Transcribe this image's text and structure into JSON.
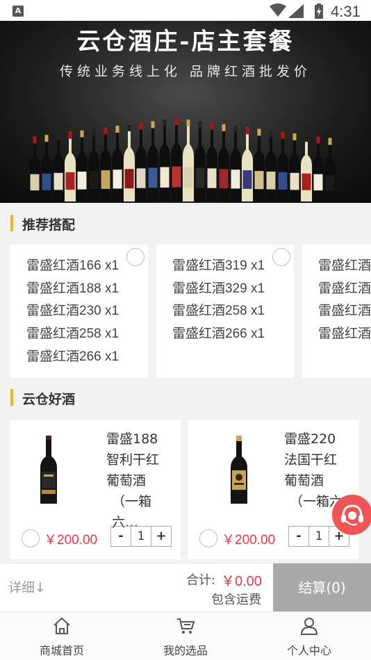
{
  "status_bar": {
    "time": "4:31",
    "left_icon": "A"
  },
  "banner": {
    "title": "云仓酒庄-店主套餐",
    "slogan": "传统业务线上化  品牌红酒批发价"
  },
  "sections": {
    "recommend": "推荐搭配",
    "good_wine": "云仓好酒"
  },
  "combos": [
    {
      "items": [
        "雷盛红酒166 x1",
        "雷盛红酒188 x1",
        "雷盛红酒230 x1",
        "雷盛红酒258 x1",
        "雷盛红酒266 x1"
      ]
    },
    {
      "items": [
        "雷盛红酒319 x1",
        "雷盛红酒329 x1",
        "雷盛红酒258 x1",
        "雷盛红酒266 x1"
      ]
    },
    {
      "items": [
        "雷盛红酒",
        "雷盛红酒",
        "雷盛红酒",
        "雷盛红酒"
      ]
    }
  ],
  "products": [
    {
      "name_lines": [
        "雷盛188",
        "智利干红",
        "葡萄酒",
        "（一箱六…"
      ],
      "price": "￥200.00",
      "qty": "1",
      "minus": "-",
      "plus": "+"
    },
    {
      "name_lines": [
        "雷盛220",
        "法国干红",
        "葡萄酒",
        "（一箱六"
      ],
      "price": "￥200.00",
      "qty": "1",
      "minus": "-",
      "plus": "+"
    }
  ],
  "checkout": {
    "detail": "详细↓",
    "total_label": "合计:",
    "total_value": "￥0.00",
    "shipping": "包含运费",
    "pay_button": "结算(0)"
  },
  "tabs": [
    {
      "label": "商城首页",
      "icon": "home-icon"
    },
    {
      "label": "我的选品",
      "icon": "cart-icon"
    },
    {
      "label": "个人中心",
      "icon": "user-icon"
    }
  ],
  "colors": {
    "accent": "#f2b400",
    "price": "#e6394a",
    "pay_button": "#a9a9a9",
    "service": "#f05454"
  }
}
